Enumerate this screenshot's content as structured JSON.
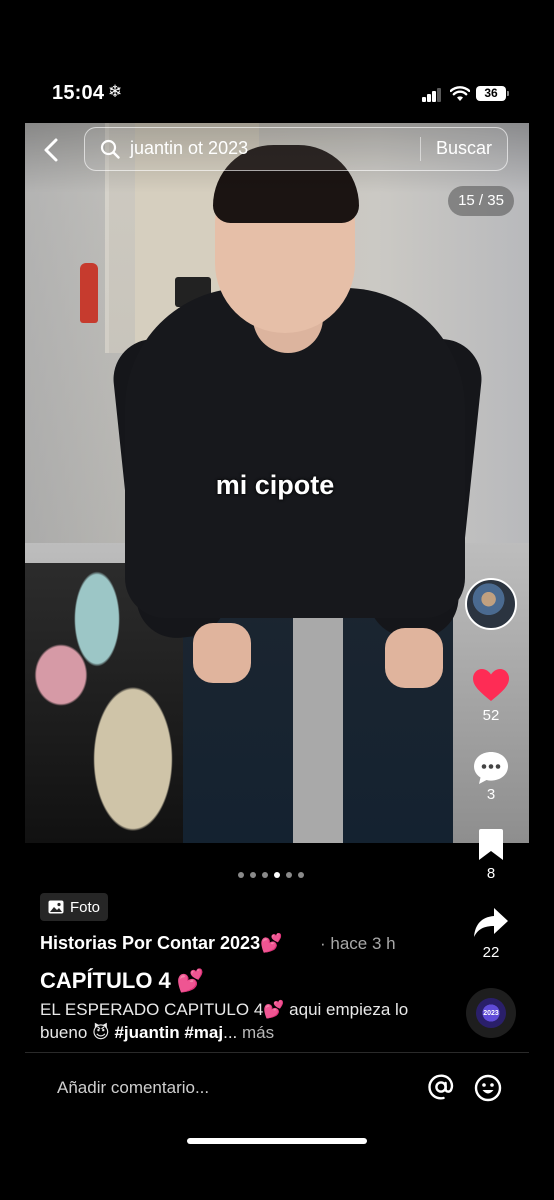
{
  "status_bar": {
    "time": "15:04",
    "snow_icon": "❄",
    "battery": "36"
  },
  "search": {
    "query": "juantin ot 2023",
    "button": "Buscar"
  },
  "photo": {
    "counter": "15 / 35",
    "caption": "mi cipote",
    "page_indicator": {
      "count": 6,
      "active_index": 3
    }
  },
  "rail": {
    "likes": "52",
    "comments": "3",
    "saves": "8",
    "shares": "22",
    "like_color": "#fe2c55"
  },
  "post": {
    "type_badge": "Foto",
    "author": "Historias Por Contar 2023💕",
    "time_ago": "· hace 3 h",
    "title": "CAPÍTULO 4 💕",
    "desc_text": "EL ESPERADO CAPITULO 4💕 aqui empieza lo bueno 😈 ",
    "desc_tags": "#juantin #maj",
    "desc_ellipsis": "...",
    "more": " más",
    "music_disc_label": "2023"
  },
  "comment_bar": {
    "placeholder": "Añadir comentario..."
  }
}
